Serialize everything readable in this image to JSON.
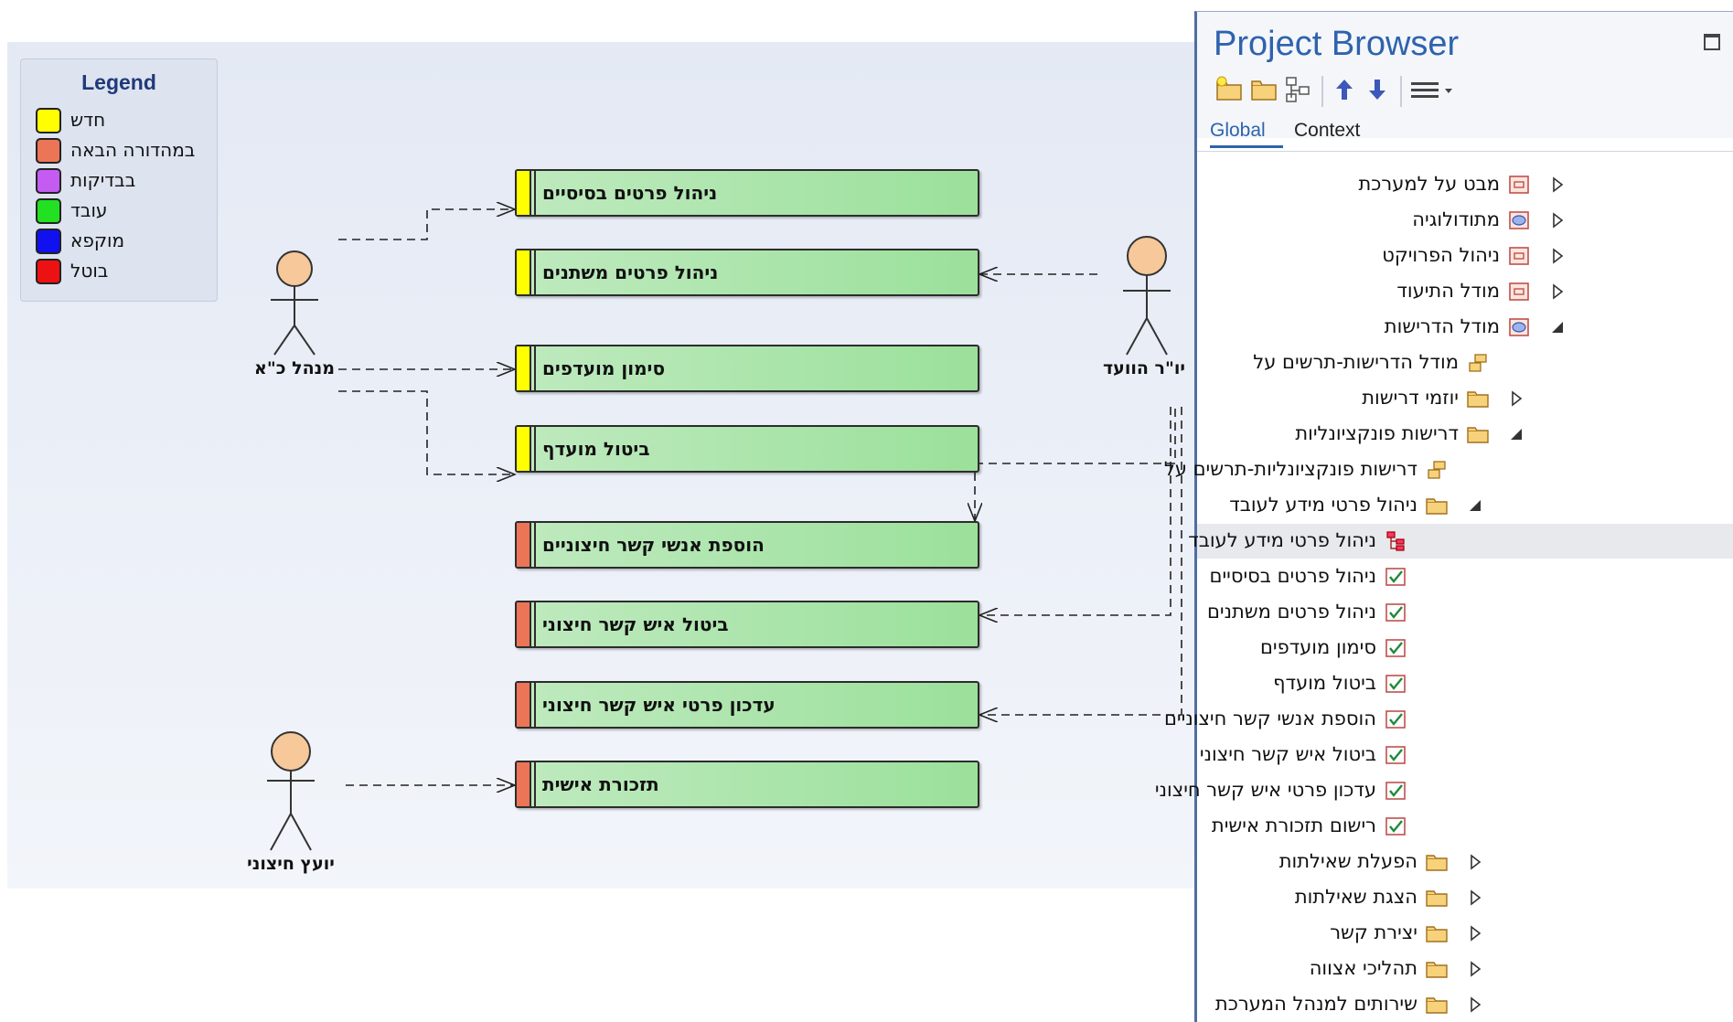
{
  "legend": {
    "title": "Legend",
    "items": [
      {
        "label": "חדש",
        "color": "#ffff00"
      },
      {
        "label": "במהדורה הבאה",
        "color": "#ec7557"
      },
      {
        "label": "בבדיקות",
        "color": "#c45cf2"
      },
      {
        "label": "עובד",
        "color": "#22e022"
      },
      {
        "label": "מוקפא",
        "color": "#1010f0"
      },
      {
        "label": "בוטל",
        "color": "#ee1111"
      }
    ]
  },
  "actors": {
    "manager": "מנהל כ\"א",
    "chair": "יו\"ר הוועד",
    "consultant": "יועץ חיצוני"
  },
  "use_cases": [
    {
      "label": "ניהול פרטים בסיסיים",
      "status_color": "#ffff00"
    },
    {
      "label": "ניהול פרטים משתנים",
      "status_color": "#ffff00"
    },
    {
      "label": "סימון מועדפים",
      "status_color": "#ffff00"
    },
    {
      "label": "ביטול מועדף",
      "status_color": "#ffff00"
    },
    {
      "label": "הוספת אנשי קשר חיצוניים",
      "status_color": "#ec7557"
    },
    {
      "label": "ביטול איש קשר חיצוני",
      "status_color": "#ec7557"
    },
    {
      "label": "עדכון פרטי איש קשר חיצוני",
      "status_color": "#ec7557"
    },
    {
      "label": "תזכורת אישית",
      "status_color": "#ec7557"
    }
  ],
  "browser": {
    "title": "Project Browser",
    "tabs": {
      "global": "Global",
      "context": "Context"
    },
    "nodes": [
      {
        "label": "מבט על למערכת",
        "icon": "package-icon",
        "expander": "collapsed"
      },
      {
        "label": "מתודולוגיה",
        "icon": "model-icon",
        "expander": "collapsed"
      },
      {
        "label": "ניהול הפרויקט",
        "icon": "package-icon",
        "expander": "collapsed"
      },
      {
        "label": "מודל התיעוד",
        "icon": "package-icon",
        "expander": "collapsed"
      },
      {
        "label": "מודל הדרישות",
        "icon": "model-icon",
        "expander": "expanded"
      },
      {
        "label": "מודל הדרישות-תרשים על",
        "icon": "diagram-icon",
        "expander": "none"
      },
      {
        "label": "יוזמי דרישות",
        "icon": "folder-icon",
        "expander": "collapsed"
      },
      {
        "label": "דרישות פונקציונליות",
        "icon": "folder-icon",
        "expander": "expanded"
      },
      {
        "label": "דרישות פונקציונליות-תרשים על",
        "icon": "diagram-icon",
        "expander": "none"
      },
      {
        "label": "ניהול פרטי מידע לעובד",
        "icon": "folder-icon",
        "expander": "expanded"
      },
      {
        "label": "ניהול פרטי מידע לעובד",
        "icon": "usecase-diagram-icon",
        "expander": "none"
      },
      {
        "label": "ניהול פרטים בסיסיים",
        "icon": "requirement-icon",
        "expander": "none"
      },
      {
        "label": "ניהול פרטים משתנים",
        "icon": "requirement-icon",
        "expander": "none"
      },
      {
        "label": "סימון מועדפים",
        "icon": "requirement-icon",
        "expander": "none"
      },
      {
        "label": "ביטול מועדף",
        "icon": "requirement-icon",
        "expander": "none"
      },
      {
        "label": "הוספת אנשי קשר חיצוניים",
        "icon": "requirement-icon",
        "expander": "none"
      },
      {
        "label": "ביטול איש קשר חיצוני",
        "icon": "requirement-icon",
        "expander": "none"
      },
      {
        "label": "עדכון פרטי איש קשר חיצוני",
        "icon": "requirement-icon",
        "expander": "none"
      },
      {
        "label": "רישום תזכורת אישית",
        "icon": "requirement-icon",
        "expander": "none"
      },
      {
        "label": "הפעלת שאילתות",
        "icon": "folder-icon",
        "expander": "collapsed"
      },
      {
        "label": "הצגת שאילתות",
        "icon": "folder-icon",
        "expander": "collapsed"
      },
      {
        "label": "יצירת קשר",
        "icon": "folder-icon",
        "expander": "collapsed"
      },
      {
        "label": "תהליכי אצווה",
        "icon": "folder-icon",
        "expander": "collapsed"
      },
      {
        "label": "שירותים למנהל המערכת",
        "icon": "folder-icon",
        "expander": "collapsed"
      }
    ]
  }
}
